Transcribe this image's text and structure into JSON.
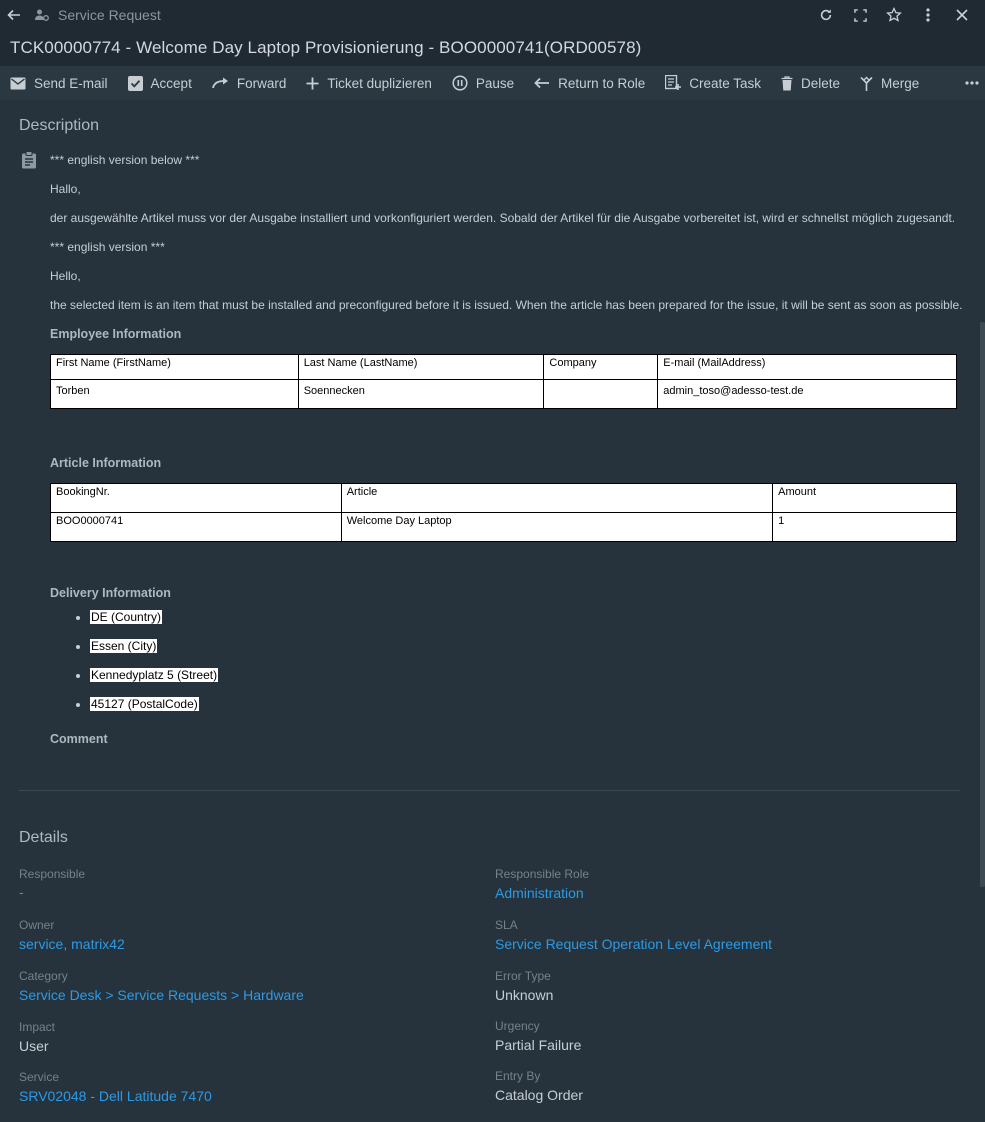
{
  "header": {
    "breadcrumb": "Service Request",
    "title": "TCK00000774 - Welcome Day Laptop Provisionierung - BOO0000741(ORD00578)"
  },
  "toolbar": {
    "send_email": "Send E-mail",
    "accept": "Accept",
    "forward": "Forward",
    "duplicate": "Ticket duplizieren",
    "pause": "Pause",
    "return_to_role": "Return to Role",
    "create_task": "Create Task",
    "delete": "Delete",
    "merge": "Merge"
  },
  "description": {
    "heading": "Description",
    "lines": [
      "*** english version below ***",
      "Hallo,",
      "der ausgewählte Artikel muss vor der Ausgabe installiert und vorkonfiguriert werden. Sobald der Artikel für die Ausgabe vorbereitet ist, wird er schnellst möglich zugesandt.",
      "*** english version ***",
      "Hello,",
      "the selected item is an item that must be installed and preconfigured before it is issued. When the article has been prepared for the issue, it will be sent as soon as possible."
    ],
    "employee": {
      "heading": "Employee Information",
      "columns": [
        "First Name (FirstName)",
        "Last Name (LastName)",
        "Company",
        "E-mail (MailAddress)"
      ],
      "row": [
        "Torben",
        "Soennecken",
        "",
        "admin_toso@adesso-test.de"
      ]
    },
    "article": {
      "heading": "Article Information",
      "columns": [
        "BookingNr.",
        "Article",
        "Amount"
      ],
      "row": [
        "BOO0000741",
        "Welcome Day Laptop",
        "1"
      ]
    },
    "delivery": {
      "heading": "Delivery Information",
      "items": [
        "DE (Country)",
        "Essen (City)",
        "Kennedyplatz 5 (Street)",
        "45127 (PostalCode)"
      ]
    },
    "comment_heading": "Comment"
  },
  "details": {
    "heading": "Details",
    "responsible": {
      "label": "Responsible",
      "value": "-"
    },
    "responsible_role": {
      "label": "Responsible Role",
      "value": "Administration"
    },
    "owner": {
      "label": "Owner",
      "value": "service, matrix42"
    },
    "sla": {
      "label": "SLA",
      "value": "Service Request Operation Level Agreement"
    },
    "category": {
      "label": "Category",
      "value": "Service Desk > Service Requests > Hardware"
    },
    "error_type": {
      "label": "Error Type",
      "value": "Unknown"
    },
    "impact": {
      "label": "Impact",
      "value": "User"
    },
    "urgency": {
      "label": "Urgency",
      "value": "Partial Failure"
    },
    "service": {
      "label": "Service",
      "value": "SRV02048 - Dell Latitude 7470"
    },
    "entry_by": {
      "label": "Entry By",
      "value": "Catalog Order"
    }
  }
}
